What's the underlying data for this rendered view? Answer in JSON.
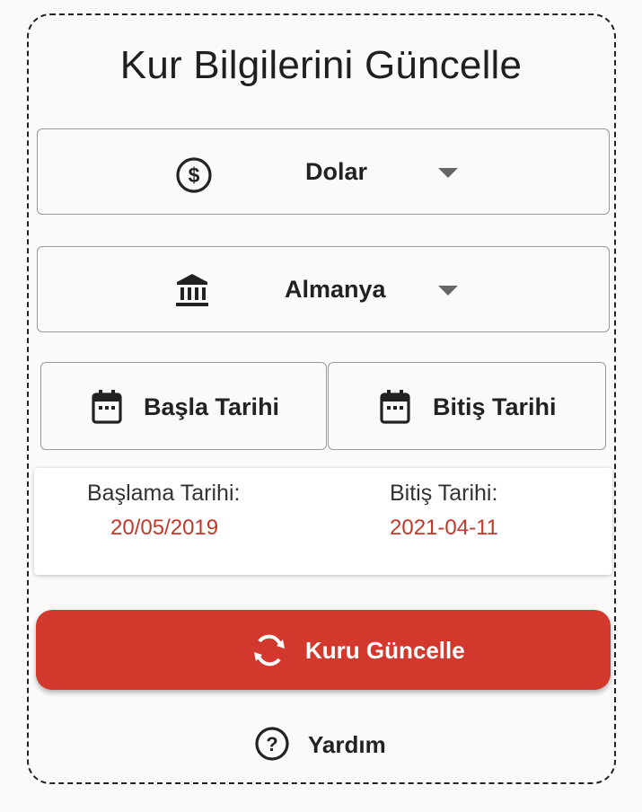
{
  "title": "Kur Bilgilerini Güncelle",
  "currency": {
    "selected": "Dolar",
    "icon": "dollar-circle-icon"
  },
  "country": {
    "selected": "Almanya",
    "icon": "bank-icon"
  },
  "dates": {
    "start_button": "Başla Tarihi",
    "end_button": "Bitiş Tarihi",
    "start_label": "Başlama Tarihi:",
    "start_value": "20/05/2019",
    "end_label": "Bitiş Tarihi:",
    "end_value": "2021-04-11"
  },
  "actions": {
    "update_label": "Kuru Güncelle",
    "help_label": "Yardım"
  },
  "colors": {
    "accent": "#d2382c",
    "date_value": "#c0392b"
  }
}
